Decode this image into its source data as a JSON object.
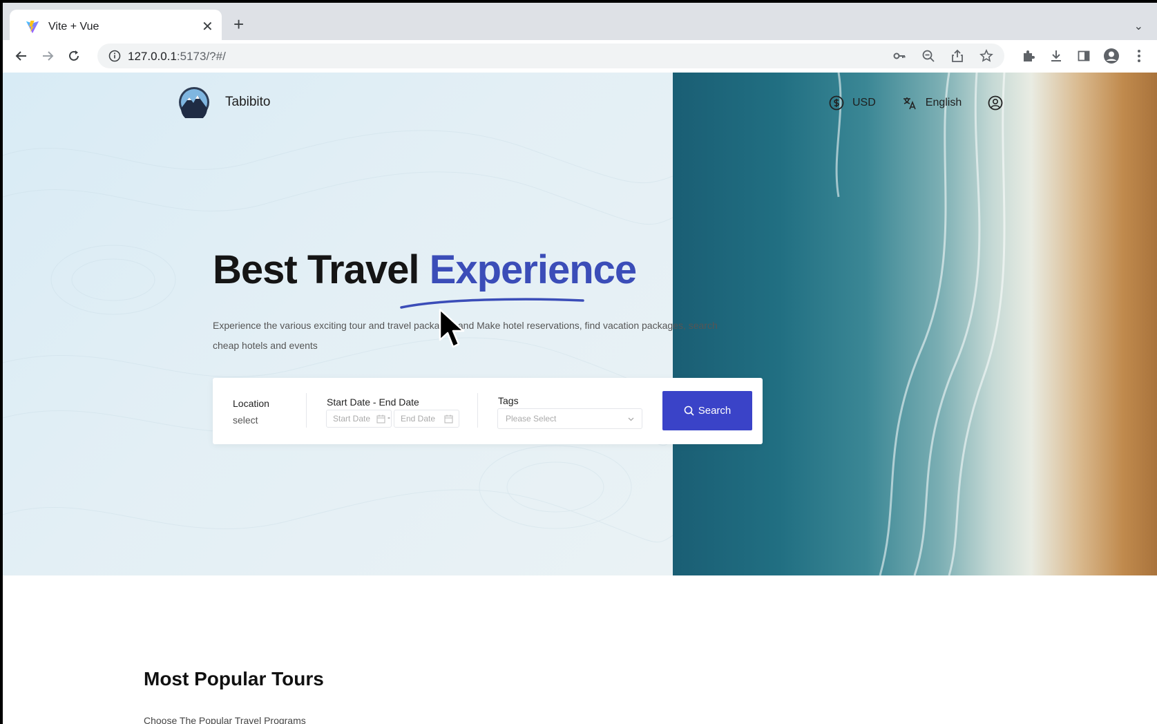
{
  "browser": {
    "tab_title": "Vite + Vue",
    "url_host": "127.0.0.1",
    "url_rest": ":5173/?#/"
  },
  "header": {
    "brand": "Tabibito",
    "currency": "USD",
    "language": "English"
  },
  "hero": {
    "headline_main": "Best Travel ",
    "headline_accent": "Experience",
    "description": "Experience the various exciting tour and travel packages and Make hotel reservations, find vacation packages, search cheap hotels and events",
    "accent_color": "#3b4db8"
  },
  "search": {
    "location_label": "Location",
    "location_value": "select",
    "date_label": "Start Date - End Date",
    "start_placeholder": "Start Date",
    "date_separator": "-",
    "end_placeholder": "End Date",
    "tags_label": "Tags",
    "tags_placeholder": "Please Select",
    "button_label": "Search",
    "button_color": "#3a43c8"
  },
  "popular": {
    "title": "Most Popular Tours",
    "subtitle": "Choose The Popular Travel Programs"
  }
}
